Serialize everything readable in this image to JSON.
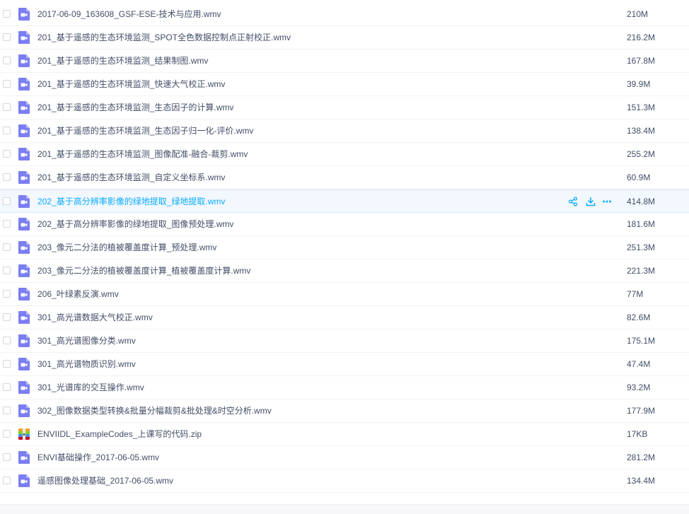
{
  "colors": {
    "video_icon": "#7b7ef2",
    "highlight_text": "#09aaff",
    "highlight_bg": "#f2f8fe",
    "text": "#424e67"
  },
  "files": [
    {
      "name": "2017-06-09_163608_GSF-ESE-技术与应用.wmv",
      "size": "210M",
      "icon": "video-file-icon"
    },
    {
      "name": "201_基于遥感的生态环境监测_SPOT全色数据控制点正射校正.wmv",
      "size": "216.2M",
      "icon": "video-file-icon"
    },
    {
      "name": "201_基于遥感的生态环境监测_结果制图.wmv",
      "size": "167.8M",
      "icon": "video-file-icon"
    },
    {
      "name": "201_基于遥感的生态环境监测_快速大气校正.wmv",
      "size": "39.9M",
      "icon": "video-file-icon"
    },
    {
      "name": "201_基于遥感的生态环境监测_生态因子的计算.wmv",
      "size": "151.3M",
      "icon": "video-file-icon"
    },
    {
      "name": "201_基于遥感的生态环境监测_生态因子归一化-评价.wmv",
      "size": "138.4M",
      "icon": "video-file-icon"
    },
    {
      "name": "201_基于遥感的生态环境监测_图像配准-融合-裁剪.wmv",
      "size": "255.2M",
      "icon": "video-file-icon"
    },
    {
      "name": "201_基于遥感的生态环境监测_自定义坐标系.wmv",
      "size": "60.9M",
      "icon": "video-file-icon"
    },
    {
      "name": "202_基于高分辨率影像的绿地提取_绿地提取.wmv",
      "size": "414.8M",
      "icon": "video-file-icon",
      "highlighted": true
    },
    {
      "name": "202_基于高分辨率影像的绿地提取_图像预处理.wmv",
      "size": "181.6M",
      "icon": "video-file-icon"
    },
    {
      "name": "203_像元二分法的植被覆盖度计算_预处理.wmv",
      "size": "251.3M",
      "icon": "video-file-icon"
    },
    {
      "name": "203_像元二分法的植被覆盖度计算_植被覆盖度计算.wmv",
      "size": "221.3M",
      "icon": "video-file-icon"
    },
    {
      "name": "206_叶绿素反演.wmv",
      "size": "77M",
      "icon": "video-file-icon"
    },
    {
      "name": "301_高光谱数据大气校正.wmv",
      "size": "82.6M",
      "icon": "video-file-icon"
    },
    {
      "name": "301_高光谱图像分类.wmv",
      "size": "175.1M",
      "icon": "video-file-icon"
    },
    {
      "name": "301_高光谱物质识别.wmv",
      "size": "47.4M",
      "icon": "video-file-icon"
    },
    {
      "name": "301_光谱库的交互操作.wmv",
      "size": "93.2M",
      "icon": "video-file-icon"
    },
    {
      "name": "302_图像数据类型转换&批量分幅裁剪&批处理&时空分析.wmv",
      "size": "177.9M",
      "icon": "video-file-icon"
    },
    {
      "name": "ENVIIDL_ExampleCodes_上课写的代码.zip",
      "size": "17KB",
      "icon": "zip-file-icon"
    },
    {
      "name": "ENVI基础操作_2017-06-05.wmv",
      "size": "281.2M",
      "icon": "video-file-icon"
    },
    {
      "name": "遥感图像处理基础_2017-06-05.wmv",
      "size": "134.4M",
      "icon": "video-file-icon"
    }
  ],
  "row_actions": [
    {
      "icon": "share-icon"
    },
    {
      "icon": "download-icon"
    },
    {
      "icon": "more-icon"
    }
  ]
}
